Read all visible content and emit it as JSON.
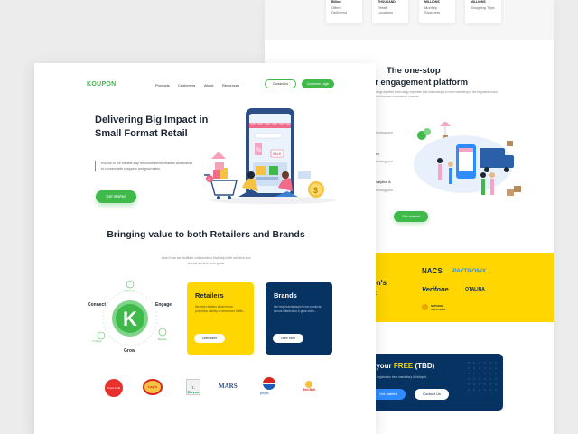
{
  "back_page": {
    "stats": [
      {
        "number": "Billion",
        "label": "Offers Delivered"
      },
      {
        "number": "THOUSAND",
        "label": "Retail Locations"
      },
      {
        "number": "MILLIONS",
        "label": "Monthly Shoppers"
      },
      {
        "number": "MILLIONS",
        "label": "Shopping Trips"
      }
    ],
    "platform_heading_line1": "The one-stop",
    "platform_heading_line2": "per engagement platform",
    "platform_sub": "brings together technology, expertise and relationships to more marketing to the fragmented and small-format convenience channel.",
    "features": [
      {
        "title": "",
        "sub": "technology and"
      },
      {
        "title": "tem",
        "sub": "technology and"
      },
      {
        "title": "Analytics &",
        "sub": "technology and"
      }
    ],
    "get_started_label": "Get started",
    "partners_heading": "pon's\nrk:",
    "partner_logos": [
      "NACS",
      "PAYTRONIX",
      "Verifone",
      "OTALINA",
      "NATIONAL SOLUTIONS"
    ],
    "cta_heading_prefix": "et your",
    "cta_heading_free": "FREE",
    "cta_heading_suffix": "(TBD)",
    "cta_sub": "ut a registration form mandatory & Hubspot.",
    "cta_get_started": "Get started",
    "cta_contact": "Contact Us"
  },
  "header": {
    "brand": "KOUPON",
    "nav": [
      "Products",
      "Customers",
      "About",
      "Resources"
    ],
    "contact_label": "Contact Us",
    "login_label": "Customer Login"
  },
  "hero": {
    "title": "Delivering Big Impact in Small Format Retail",
    "body": "Koupon is the easiest way for convenience retailers and brands to connect with shoppers and grow sales.",
    "cta": "Get started",
    "sale_tag": "SALE",
    "percent": "%",
    "coin": "$",
    "badge_number": "3"
  },
  "value": {
    "title": "Bringing value to both Retailers and Brands",
    "subtitle": "Learn how we facilitate collaboration that help both retailers and brands achieve their goals"
  },
  "wheel": {
    "center": "K",
    "connect": "Connect",
    "engage": "Engage",
    "grow": "Grow",
    "small_top": "Shoppers",
    "small_left": "In Store",
    "small_right": "Brands"
  },
  "cards": {
    "retailers": {
      "title": "Retailers",
      "desc": "We help retailers attract more promotion activity to drive more traffic...",
      "button": "Learn More"
    },
    "brands": {
      "title": "Brands",
      "desc": "We help brands launch new products, secure distribution & grow sales...",
      "button": "Learn More"
    }
  },
  "client_logos": [
    "Coca-Cola",
    "Lay's",
    "7-Eleven",
    "MARS",
    "pepsi",
    "Red Bull"
  ],
  "colors": {
    "green": "#3fb94a",
    "yellow": "#ffd600",
    "navy": "#073363"
  }
}
